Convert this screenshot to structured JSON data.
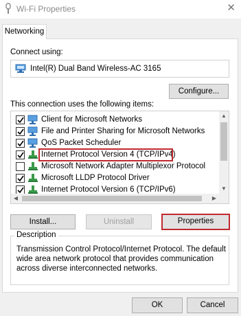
{
  "window": {
    "title": "Wi-Fi Properties",
    "close_glyph": "✕"
  },
  "tabs": [
    {
      "label": "Networking",
      "active": true
    }
  ],
  "connect_using": {
    "label": "Connect using:",
    "adapter": "Intel(R) Dual Band Wireless-AC 3165",
    "configure_label": "Configure..."
  },
  "items_section": {
    "label": "This connection uses the following items:",
    "items": [
      {
        "label": "Client for Microsoft Networks",
        "checked": true,
        "icon": "network-client-icon"
      },
      {
        "label": "File and Printer Sharing for Microsoft Networks",
        "checked": true,
        "icon": "network-service-icon"
      },
      {
        "label": "QoS Packet Scheduler",
        "checked": true,
        "icon": "network-service-icon"
      },
      {
        "label": "Internet Protocol Version 4 (TCP/IPv4)",
        "checked": true,
        "icon": "network-protocol-icon",
        "selected": true
      },
      {
        "label": "Microsoft Network Adapter Multiplexor Protocol",
        "checked": false,
        "icon": "network-protocol-icon"
      },
      {
        "label": "Microsoft LLDP Protocol Driver",
        "checked": true,
        "icon": "network-protocol-icon"
      },
      {
        "label": "Internet Protocol Version 6 (TCP/IPv6)",
        "checked": true,
        "icon": "network-protocol-icon"
      }
    ]
  },
  "actions": {
    "install": "Install...",
    "uninstall": "Uninstall",
    "properties": "Properties"
  },
  "description": {
    "legend": "Description",
    "text": "Transmission Control Protocol/Internet Protocol. The default wide area network protocol that provides communication across diverse interconnected networks."
  },
  "footer": {
    "ok": "OK",
    "cancel": "Cancel"
  },
  "colors": {
    "highlight": "#c0282e",
    "icon_blue": "#2f7fd0",
    "icon_green": "#3a9a4a"
  }
}
